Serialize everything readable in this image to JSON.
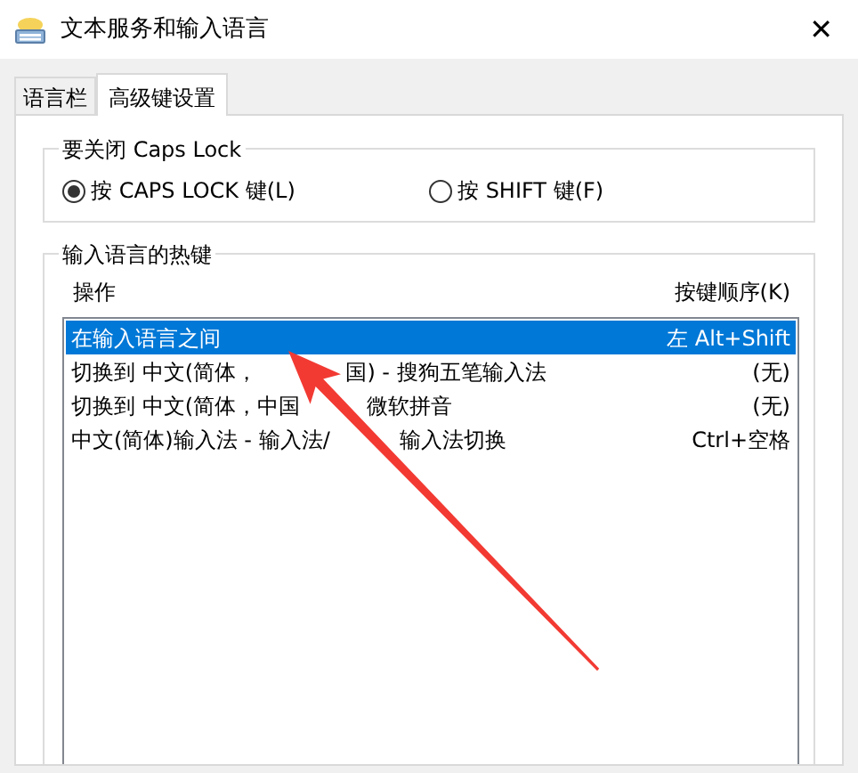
{
  "window": {
    "title": "文本服务和输入语言",
    "close": "✕"
  },
  "tabs": [
    {
      "label": "语言栏",
      "selected": false
    },
    {
      "label": "高级键设置",
      "selected": true
    }
  ],
  "caps_lock_group": {
    "title": "要关闭 Caps Lock",
    "options": [
      {
        "label": "按 CAPS LOCK 键(L)",
        "selected": true
      },
      {
        "label": "按 SHIFT 键(F)",
        "selected": false
      }
    ]
  },
  "hotkey_group": {
    "title": "输入语言的热键",
    "columns": [
      "操作",
      "按键顺序(K)"
    ],
    "rows": [
      {
        "action_parts": [
          "在输入语言之间"
        ],
        "keys": "左 Alt+Shift",
        "selected": true
      },
      {
        "action_parts": [
          "切换到 中文(简体，",
          "国) - 搜狗五笔输入法"
        ],
        "keys": "(无)",
        "selected": false
      },
      {
        "action_parts": [
          "切换到 中文(简体，中国",
          "微软拼音"
        ],
        "keys": "(无)",
        "selected": false
      },
      {
        "action_parts": [
          "中文(简体)输入法 - 输入法/",
          "输入法切换"
        ],
        "keys": "Ctrl+空格",
        "selected": false
      }
    ]
  }
}
